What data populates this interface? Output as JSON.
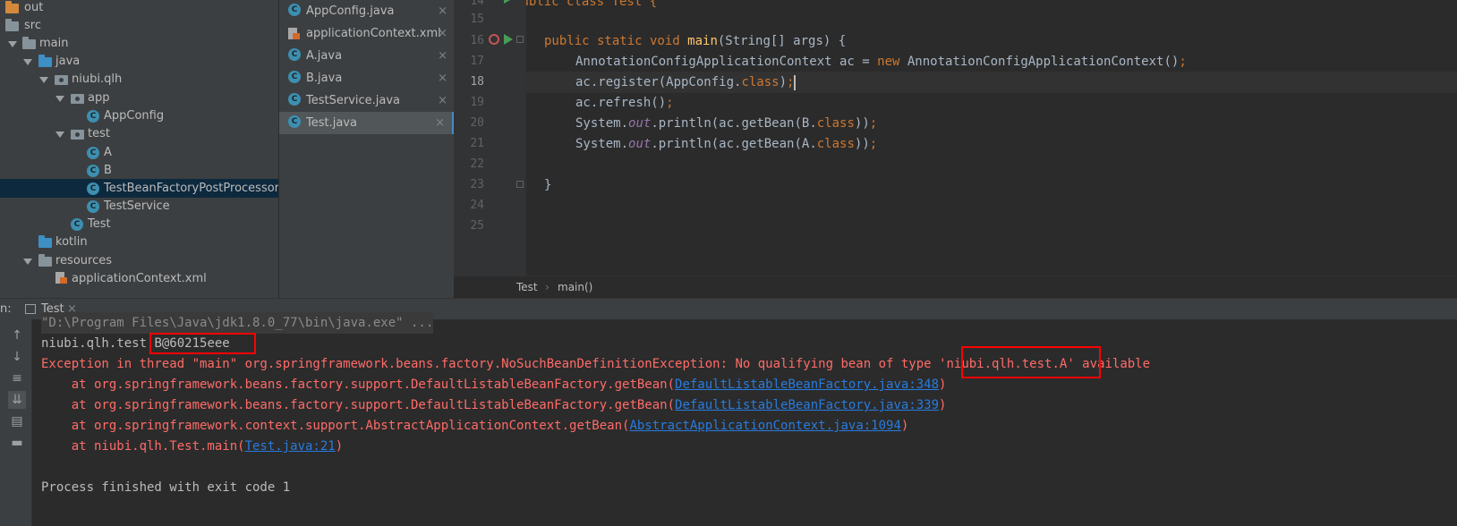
{
  "project_tree": {
    "items": [
      {
        "label": "out",
        "icon": "folder-orange-icon",
        "arrow": false
      },
      {
        "label": "src",
        "icon": "folder-icon",
        "arrow": false
      },
      {
        "label": "main",
        "icon": "folder-icon",
        "arrow": true
      },
      {
        "label": "java",
        "icon": "folder-blue-icon",
        "arrow": true
      },
      {
        "label": "niubi.qlh",
        "icon": "package-icon",
        "arrow": true
      },
      {
        "label": "app",
        "icon": "package-icon",
        "arrow": true
      },
      {
        "label": "AppConfig",
        "icon": "class-icon",
        "arrow": false
      },
      {
        "label": "test",
        "icon": "package-icon",
        "arrow": true
      },
      {
        "label": "A",
        "icon": "class-icon",
        "arrow": false
      },
      {
        "label": "B",
        "icon": "class-icon",
        "arrow": false
      },
      {
        "label": "TestBeanFactoryPostProcessor",
        "icon": "class-icon",
        "arrow": false,
        "selected": true
      },
      {
        "label": "TestService",
        "icon": "class-icon",
        "arrow": false
      },
      {
        "label": "Test",
        "icon": "class-icon",
        "arrow": false
      },
      {
        "label": "kotlin",
        "icon": "folder-blue-icon",
        "arrow": false
      },
      {
        "label": "resources",
        "icon": "folder-icon",
        "arrow": true
      },
      {
        "label": "applicationContext.xml",
        "icon": "xml-file-icon",
        "arrow": false
      }
    ]
  },
  "editor_tabs": [
    {
      "label": "AppConfig.java",
      "icon": "class-icon",
      "active": false
    },
    {
      "label": "applicationContext.xml",
      "icon": "xml-file-icon",
      "active": false
    },
    {
      "label": "A.java",
      "icon": "class-icon",
      "active": false
    },
    {
      "label": "B.java",
      "icon": "class-icon",
      "active": false
    },
    {
      "label": "TestService.java",
      "icon": "class-icon",
      "active": false
    },
    {
      "label": "Test.java",
      "icon": "class-icon",
      "active": true
    }
  ],
  "tab_close_glyph": "×",
  "editor": {
    "line_numbers": [
      "14",
      "15",
      "16",
      "17",
      "18",
      "19",
      "20",
      "21",
      "22",
      "23",
      "24",
      "25"
    ],
    "line_14": "public class Test {",
    "l16_kw": "public static void ",
    "l16_fn": "main",
    "l16_rest": "(String[] args) {",
    "l17_a": "AnnotationConfigApplicationContext ac = ",
    "l17_kw": "new",
    "l17_b": " AnnotationConfigApplicationContext()",
    "l17_semi": ";",
    "l18_a": "ac.register(AppConfig.",
    "l18_kw": "class",
    "l18_b": ")",
    "l18_semi": ";",
    "l19_a": "ac.refresh()",
    "l19_semi": ";",
    "l20_a": "System.",
    "l20_out": "out",
    "l20_b": ".println(ac.getBean(B.",
    "l20_kw": "class",
    "l20_c": "))",
    "l20_semi": ";",
    "l21_a": "System.",
    "l21_out": "out",
    "l21_b": ".println(ac.getBean(A.",
    "l21_kw": "class",
    "l21_c": "))",
    "l21_semi": ";",
    "l23": "}",
    "l24": "}",
    "current_line": "18"
  },
  "breadcrumbs": {
    "class": "Test",
    "separator": "›",
    "method": "main()"
  },
  "run_panel": {
    "prefix": "n:",
    "tab_label": "Test",
    "tab_close": "×"
  },
  "console": {
    "cmd_line": "\"D:\\Program Files\\Java\\jdk1.8.0_77\\bin\\java.exe\" ...",
    "out_prefix": "niubi.qlh.test",
    "out_highlight": ".B@60215eee",
    "exc_text": "Exception in thread \"main\" org.springframework.beans.factory.NoSuchBeanDefinitionException: No qualifying bean of type ",
    "exc_highlight": "'niubi.qlh.test.A'",
    "exc_tail": " available",
    "stack": [
      {
        "text": "    at org.springframework.beans.factory.support.DefaultListableBeanFactory.getBean(",
        "link": "DefaultListableBeanFactory.java:348",
        "end": ")"
      },
      {
        "text": "    at org.springframework.beans.factory.support.DefaultListableBeanFactory.getBean(",
        "link": "DefaultListableBeanFactory.java:339",
        "end": ")"
      },
      {
        "text": "    at org.springframework.context.support.AbstractApplicationContext.getBean(",
        "link": "AbstractApplicationContext.java:1094",
        "end": ")"
      },
      {
        "text": "    at niubi.qlh.Test.main(",
        "link": "Test.java:21",
        "end": ")"
      }
    ],
    "exit_line": "Process finished with exit code 1"
  },
  "colors": {
    "highlight_box": "#ff0000",
    "error_text": "#ff6b68",
    "link": "#287bde",
    "keyword": "#cc7832",
    "method": "#ffc66d"
  }
}
